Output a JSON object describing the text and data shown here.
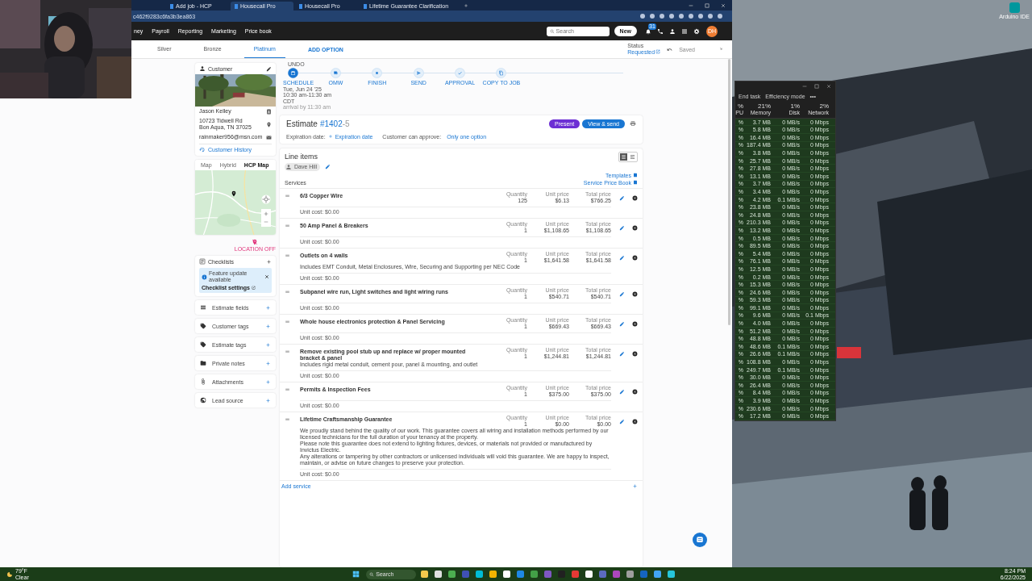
{
  "browser": {
    "tabs": [
      {
        "title": "Add job - HCP",
        "selected": false
      },
      {
        "title": "Housecall Pro",
        "selected": true
      },
      {
        "title": "Housecall Pro",
        "selected": false
      },
      {
        "title": "Lifetime Guarantee Clarification",
        "selected": false
      }
    ],
    "url": "c462f9283c6fa3b3ea863"
  },
  "nav": {
    "items": [
      "ney",
      "Payroll",
      "Reporting",
      "Marketing",
      "Price book"
    ],
    "search_placeholder": "Search",
    "new_button": "New",
    "notifications": "31",
    "avatar": "DH"
  },
  "options": {
    "tabs": [
      {
        "label": "Silver",
        "selected": false
      },
      {
        "label": "Bronze",
        "selected": false
      },
      {
        "label": "Platinum",
        "selected": true
      }
    ],
    "add_option": "ADD OPTION",
    "status_label": "Status",
    "status": "Requested",
    "saved": "Saved"
  },
  "timeline": {
    "undo": "UNDO",
    "steps": [
      {
        "label": "SCHEDULE",
        "completed": true
      },
      {
        "label": "OMW",
        "completed": false
      },
      {
        "label": "FINISH",
        "completed": false
      },
      {
        "label": "SEND",
        "completed": false
      },
      {
        "label": "APPROVAL",
        "completed": false
      },
      {
        "label": "COPY TO JOB",
        "completed": false
      }
    ],
    "schedule_details": [
      "Tue, Jun 24 '25",
      "10:30 am-11:30 am",
      "CDT"
    ],
    "schedule_note": "arrival by 11:30 am"
  },
  "customer": {
    "title": "Customer",
    "name": "Jason Kelley",
    "address": [
      "10723 Tidwell Rd",
      "Bon Aqua, TN 37025"
    ],
    "email": "rainmaker956@msn.com",
    "history": "Customer History"
  },
  "map": {
    "tabs": [
      {
        "label": "Map",
        "selected": false
      },
      {
        "label": "Hybrid",
        "selected": false
      },
      {
        "label": "HCP Map",
        "selected": true
      }
    ],
    "location": "LOCATION OFF"
  },
  "checklists": {
    "title": "Checklists",
    "notice": "Feature update available",
    "settings": "Checklist settings"
  },
  "sections": [
    "Estimate fields",
    "Customer tags",
    "Estimate tags",
    "Private notes",
    "Attachments",
    "Lead source"
  ],
  "estimate": {
    "title": "Estimate",
    "number": "#1402",
    "suffix": "-5",
    "present": "Present",
    "view_send": "View & send",
    "expiration_label": "Expiration date:",
    "expiration_action": "Expiration date",
    "approve_label": "Customer can approve:",
    "approve_value": "Only one option"
  },
  "line_items": {
    "title": "Line items",
    "employee": "Dave Hill",
    "templates": "Templates",
    "section": "Services",
    "price_book": "Service Price Book",
    "add": "Add service",
    "items": [
      {
        "name": "6/3 Copper Wire",
        "labels": [
          "Quantity",
          "Unit price",
          "Total price"
        ],
        "quantity": "125",
        "unit_price": "$6.13",
        "total_price": "$766.25",
        "unit_cost": "Unit cost: $0.00"
      },
      {
        "name": "50 Amp Panel & Breakers",
        "labels": [
          "Quantity",
          "Unit price",
          "Total price"
        ],
        "quantity": "1",
        "unit_price": "$1,108.65",
        "total_price": "$1,108.65",
        "unit_cost": "Unit cost: $0.00"
      },
      {
        "name": "Outlets on 4 walls",
        "labels": [
          "Quantity",
          "Unit price",
          "Total price"
        ],
        "quantity": "1",
        "unit_price": "$1,641.58",
        "total_price": "$1,641.58",
        "description": [
          "Includes EMT Conduit, Metal Enclosures, Wire, Securing and Supporting per NEC Code"
        ],
        "unit_cost": "Unit cost: $0.00"
      },
      {
        "name": "Subpanel wire run, Light switches and light wiring runs",
        "labels": [
          "Quantity",
          "Unit price",
          "Total price"
        ],
        "quantity": "1",
        "unit_price": "$540.71",
        "total_price": "$540.71",
        "unit_cost": "Unit cost: $0.00"
      },
      {
        "name": "Whole house electronics protection & Panel Servicing",
        "labels": [
          "Quantity",
          "Unit price",
          "Total price"
        ],
        "quantity": "1",
        "unit_price": "$669.43",
        "total_price": "$669.43",
        "unit_cost": "Unit cost: $0.00"
      },
      {
        "name": "Remove existing pool stub up and replace w/ proper mounted bracket & panel",
        "labels": [
          "Quantity",
          "Unit price",
          "Total price"
        ],
        "quantity": "1",
        "unit_price": "$1,244.81",
        "total_price": "$1,244.81",
        "description": [
          "Includes rigid metal conduit, cement pour, panel & mounting, and outlet"
        ],
        "unit_cost": "Unit cost: $0.00"
      },
      {
        "name": "Permits & Inspection Fees",
        "labels": [
          "Quantity",
          "Unit price",
          "Total price"
        ],
        "quantity": "1",
        "unit_price": "$375.00",
        "total_price": "$375.00",
        "unit_cost": "Unit cost: $0.00"
      },
      {
        "name": "Lifetime Craftsmanship Guarantee",
        "labels": [
          "Quantity",
          "Unit price",
          "Total price"
        ],
        "quantity": "1",
        "unit_price": "$0.00",
        "total_price": "$0.00",
        "description": [
          "We proudly stand behind the quality of our work. This guarantee covers all wiring and installation methods performed by our licensed technicians for the full duration of your tenancy at the property.",
          "Please note this guarantee does not extend to lighting fixtures, devices, or materials not provided or manufactured by Invictus Electric.",
          "Any alterations or tampering by other contractors or unlicensed individuals will void this guarantee. We are happy to inspect, maintain, or advise on future changes to preserve your protection."
        ],
        "unit_cost": "Unit cost: $0.00"
      }
    ]
  },
  "task_manager": {
    "toolbar": [
      "End task",
      "Efficiency mode"
    ],
    "more": "•••",
    "columns": [
      {
        "value": "%",
        "label": "PU"
      },
      {
        "value": "21%",
        "label": "Memory"
      },
      {
        "value": "1%",
        "label": "Disk"
      },
      {
        "value": "2%",
        "label": "Network"
      }
    ],
    "rows": [
      {
        "cpu": "%",
        "memory": "3.7 MB",
        "disk": "0 MB/s",
        "network": "0 Mbps"
      },
      {
        "cpu": "%",
        "memory": "5.8 MB",
        "disk": "0 MB/s",
        "network": "0 Mbps"
      },
      {
        "cpu": "%",
        "memory": "16.4 MB",
        "disk": "0 MB/s",
        "network": "0 Mbps"
      },
      {
        "cpu": "%",
        "memory": "187.4 MB",
        "disk": "0 MB/s",
        "network": "0 Mbps"
      },
      {
        "cpu": "%",
        "memory": "3.8 MB",
        "disk": "0 MB/s",
        "network": "0 Mbps"
      },
      {
        "cpu": "%",
        "memory": "25.7 MB",
        "disk": "0 MB/s",
        "network": "0 Mbps"
      },
      {
        "cpu": "%",
        "memory": "27.8 MB",
        "disk": "0 MB/s",
        "network": "0 Mbps"
      },
      {
        "cpu": "%",
        "memory": "13.1 MB",
        "disk": "0 MB/s",
        "network": "0 Mbps"
      },
      {
        "cpu": "%",
        "memory": "3.7 MB",
        "disk": "0 MB/s",
        "network": "0 Mbps"
      },
      {
        "cpu": "%",
        "memory": "3.4 MB",
        "disk": "0 MB/s",
        "network": "0 Mbps"
      },
      {
        "cpu": "%",
        "memory": "4.2 MB",
        "disk": "0.1 MB/s",
        "network": "0 Mbps"
      },
      {
        "cpu": "%",
        "memory": "23.8 MB",
        "disk": "0 MB/s",
        "network": "0 Mbps"
      },
      {
        "cpu": "%",
        "memory": "24.8 MB",
        "disk": "0 MB/s",
        "network": "0 Mbps"
      },
      {
        "cpu": "%",
        "memory": "210.3 MB",
        "disk": "0 MB/s",
        "network": "0 Mbps"
      },
      {
        "cpu": "%",
        "memory": "13.2 MB",
        "disk": "0 MB/s",
        "network": "0 Mbps"
      },
      {
        "cpu": "%",
        "memory": "0.5 MB",
        "disk": "0 MB/s",
        "network": "0 Mbps"
      },
      {
        "cpu": "%",
        "memory": "89.5 MB",
        "disk": "0 MB/s",
        "network": "0 Mbps"
      },
      {
        "cpu": "%",
        "memory": "5.4 MB",
        "disk": "0 MB/s",
        "network": "0 Mbps"
      },
      {
        "cpu": "%",
        "memory": "76.1 MB",
        "disk": "0 MB/s",
        "network": "0 Mbps"
      },
      {
        "cpu": "%",
        "memory": "12.5 MB",
        "disk": "0 MB/s",
        "network": "0 Mbps"
      },
      {
        "cpu": "%",
        "memory": "0.2 MB",
        "disk": "0 MB/s",
        "network": "0 Mbps"
      },
      {
        "cpu": "%",
        "memory": "15.3 MB",
        "disk": "0 MB/s",
        "network": "0 Mbps"
      },
      {
        "cpu": "%",
        "memory": "24.6 MB",
        "disk": "0 MB/s",
        "network": "0 Mbps"
      },
      {
        "cpu": "%",
        "memory": "59.3 MB",
        "disk": "0 MB/s",
        "network": "0 Mbps"
      },
      {
        "cpu": "%",
        "memory": "99.1 MB",
        "disk": "0 MB/s",
        "network": "0 Mbps"
      },
      {
        "cpu": "%",
        "memory": "9.6 MB",
        "disk": "0 MB/s",
        "network": "0.1 Mbps"
      },
      {
        "cpu": "%",
        "memory": "4.0 MB",
        "disk": "0 MB/s",
        "network": "0 Mbps"
      },
      {
        "cpu": "%",
        "memory": "51.2 MB",
        "disk": "0 MB/s",
        "network": "0 Mbps"
      },
      {
        "cpu": "%",
        "memory": "48.8 MB",
        "disk": "0 MB/s",
        "network": "0 Mbps"
      },
      {
        "cpu": "%",
        "memory": "48.6 MB",
        "disk": "0.1 MB/s",
        "network": "0 Mbps"
      },
      {
        "cpu": "%",
        "memory": "26.6 MB",
        "disk": "0.1 MB/s",
        "network": "0 Mbps"
      },
      {
        "cpu": "%",
        "memory": "108.8 MB",
        "disk": "0 MB/s",
        "network": "0 Mbps"
      },
      {
        "cpu": "%",
        "memory": "249.7 MB",
        "disk": "0.1 MB/s",
        "network": "0 Mbps"
      },
      {
        "cpu": "%",
        "memory": "30.0 MB",
        "disk": "0 MB/s",
        "network": "0 Mbps"
      },
      {
        "cpu": "%",
        "memory": "26.4 MB",
        "disk": "0 MB/s",
        "network": "0 Mbps"
      },
      {
        "cpu": "%",
        "memory": "8.4 MB",
        "disk": "0 MB/s",
        "network": "0 Mbps"
      },
      {
        "cpu": "%",
        "memory": "3.9 MB",
        "disk": "0 MB/s",
        "network": "0 Mbps"
      },
      {
        "cpu": "%",
        "memory": "230.6 MB",
        "disk": "0 MB/s",
        "network": "0 Mbps"
      },
      {
        "cpu": "%",
        "memory": "17.2 MB",
        "disk": "0 MB/s",
        "network": "0 Mbps"
      }
    ]
  },
  "desktop_icon": "Arduino IDE",
  "taskbar": {
    "temperature": "79°F",
    "weather": "Clear",
    "search_placeholder": "Search",
    "time": "8:24 PM",
    "date": "6/22/2025",
    "apps": [
      {
        "color": "#f2c94c"
      },
      {
        "color": "#e0e0e0"
      },
      {
        "color": "#4caf50"
      },
      {
        "color": "#3f51b5"
      },
      {
        "color": "#00bcd4"
      },
      {
        "color": "#f4b400"
      },
      {
        "color": "#ffffff"
      },
      {
        "color": "#1e88e5"
      },
      {
        "color": "#43a047"
      },
      {
        "color": "#7e57c2"
      },
      {
        "color": "#212121"
      },
      {
        "color": "#e53935"
      },
      {
        "color": "#fafafa"
      },
      {
        "color": "#5c6bc0"
      },
      {
        "color": "#ab47bc"
      },
      {
        "color": "#9e9e9e"
      },
      {
        "color": "#1565c0"
      },
      {
        "color": "#42a5f5"
      },
      {
        "color": "#26c6da"
      }
    ]
  }
}
